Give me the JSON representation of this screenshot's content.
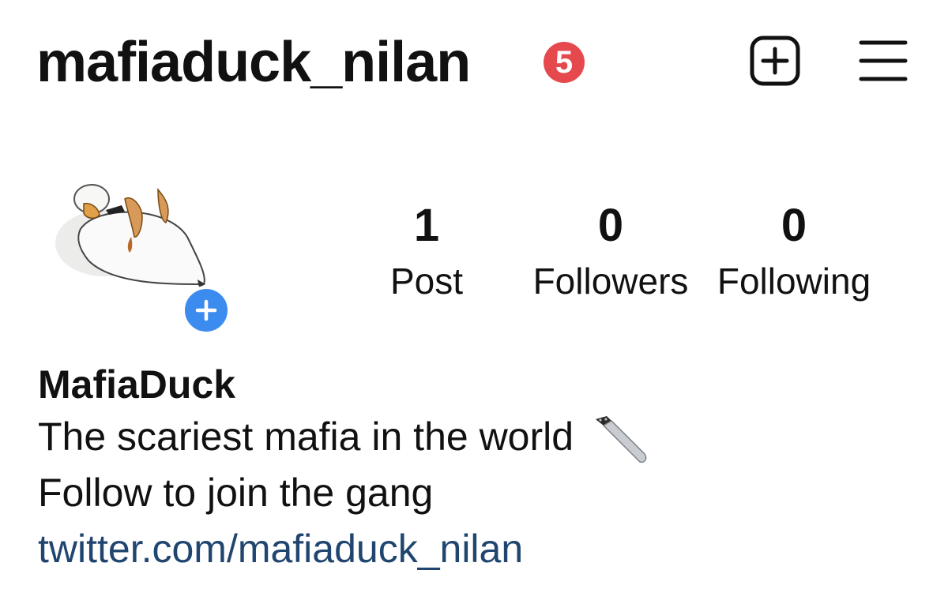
{
  "header": {
    "username": "mafiaduck_nilan",
    "notification_count": "5",
    "new_post_icon": "plus-square-icon",
    "menu_icon": "hamburger-menu-icon"
  },
  "avatar": {
    "image": "white duck illustration",
    "add_icon": "plus-circle-icon",
    "add_color": "#3c8cf0"
  },
  "stats": {
    "posts": {
      "count": "1",
      "label": "Post"
    },
    "followers": {
      "count": "0",
      "label": "Followers"
    },
    "following": {
      "count": "0",
      "label": "Following"
    }
  },
  "bio": {
    "display_name": "MafiaDuck",
    "line1": "The scariest mafia in the world",
    "line1_emoji": "knife-icon",
    "line2": "Follow to join the gang",
    "link": "twitter.com/mafiaduck_nilan",
    "link_color": "#20466f"
  },
  "colors": {
    "badge": "#e5484d",
    "text": "#111111"
  }
}
